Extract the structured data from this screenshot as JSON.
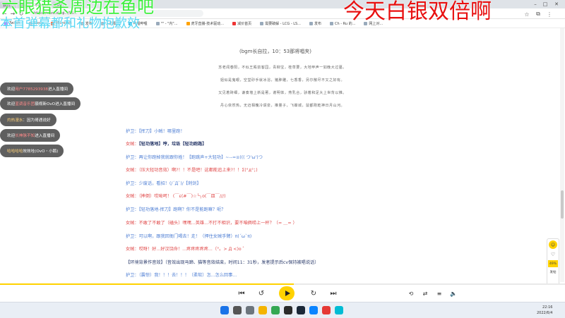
{
  "browser": {
    "tabs": [
      {
        "label": "我的..."
      },
      {
        "label": "语..."
      },
      {
        "label": "不存在..."
      },
      {
        "label": "[只]"
      }
    ],
    "url": "https://www.xiaqi.../56...",
    "bookmarks": [
      "Twitch",
      "Apps",
      "Microsoft",
      "发布",
      "人的要...",
      "哔哩哔哩",
      "\"\" - \"内\"...",
      "虎牙直播-技术驱动...",
      "减价首页",
      "需要破解 - LCG - LS...",
      "发布",
      "Ch - Ru 的...",
      "网上对..."
    ]
  },
  "overlays": {
    "left_line1": "六眼猎杀周边在鱼吧",
    "left_line2": "本首弹幕都和礼物抱歉效",
    "right": "今天白银双倍啊"
  },
  "document": {
    "bgm": "(bgm长自拉，10：53那将唱夹)",
    "poem": [
      "苏老闻春阳，不似王殿前客园，青柳宝，桂草要，大地甲声一如晚大过墓。",
      "姐似是鬼眼，空堂砂手就冰浴，猪肿雕，七香香，另尔散尽不又之好有。",
      "又见着砖细，谦奏墙上新是著，谢明体，燕乳合，骄着和足大上世背以推。",
      "丹心依然热，无迈相魄冷谓泉，推量子，飞蝶城，鼠都刚乾神日月山河。"
    ],
    "lines": [
      {
        "speaker": "护卫：",
        "text": "【挥刀】小贼！哪里跑！",
        "color": "blue"
      },
      {
        "speaker": "女贼：",
        "text": "【轻功落地】哼，垃圾【轻功跑路】",
        "color": "red"
      },
      {
        "speaker": "护卫：",
        "text": "再让你跑掉我就跟你姓！【跑跳声+大轻功】~--=≡((( つ'ω')つ",
        "color": "blue"
      },
      {
        "speaker": "女贼：",
        "text": "（压大轻功音效）啊?！！不是吧！这都能追上来?！！Σ(°д°；)",
        "color": "red"
      },
      {
        "speaker": "护卫：",
        "text": "少废话，看招！(/´Д`)/【刺剑】",
        "color": "blue"
      },
      {
        "speaker": "女贼：",
        "text": "（摔倒）哎呦呵！ (￣ε(#￣)☆╰╮o(￣皿￣///)",
        "color": "red"
      },
      {
        "speaker": "护卫：",
        "text": "【轻功落地-挥刀】跑啊？你不是能跑嘛？呃？",
        "color": "blue"
      },
      {
        "speaker": "女贼：",
        "text": "不敢了不敢了（磕头）嘿嘿...英雄...不打不相识，要不咱俩唠上一杯？（= ＿= ）",
        "color": "red"
      },
      {
        "speaker": "护卫：",
        "text": "可以啊，跟我回衙门喝去！走！（押住女贼手臂）π(´ω`π)",
        "color": "blue"
      },
      {
        "speaker": "女贼：",
        "text": "哎呀！好...好汉饶命！...疼疼疼疼疼...（°。> Д <)o ゜",
        "color": "red"
      },
      {
        "speaker": "",
        "text": "【环境背景作音效】（音效出现马蹄、猫等音效结束，时间11：31秒，发者提示后cv保持被唱说话）",
        "color": "dark"
      },
      {
        "speaker": "护卫：",
        "text": "（震惊）我！！！去！！！（柔软）怎...怎么回事...",
        "color": "blue"
      }
    ]
  },
  "chat": [
    {
      "prefix": "欢迎",
      "name": "用户7785293938",
      "suffix": "进入直播间"
    },
    {
      "prefix": "欢迎",
      "name": "蓝调音乐团",
      "suffix": "藐视新OvO进入直播间"
    },
    {
      "prefix": "",
      "name": "灼热漫水",
      "suffix": "：因为哥遇说好"
    },
    {
      "prefix": "欢迎",
      "name": "长神脉不知",
      "suffix": "进入直播间"
    },
    {
      "prefix": "",
      "name": "哈哈哈哈",
      "suffix": "效效哇(OvO・小鹅)"
    }
  ],
  "side_widget": {
    "top_icon": "yellow-face-icon",
    "heart_label": "♡",
    "percent": "49%",
    "text": "发帖"
  },
  "player": {
    "progress": 0.52
  },
  "tray": {
    "time": "22:16",
    "date": "2022/6/4"
  },
  "colors": {
    "accent": "#ffd200",
    "speaker_guard": "#4f7fd4",
    "speaker_thief": "#e04848",
    "overlay_green": "#3cf03c",
    "overlay_red": "#e81010"
  }
}
